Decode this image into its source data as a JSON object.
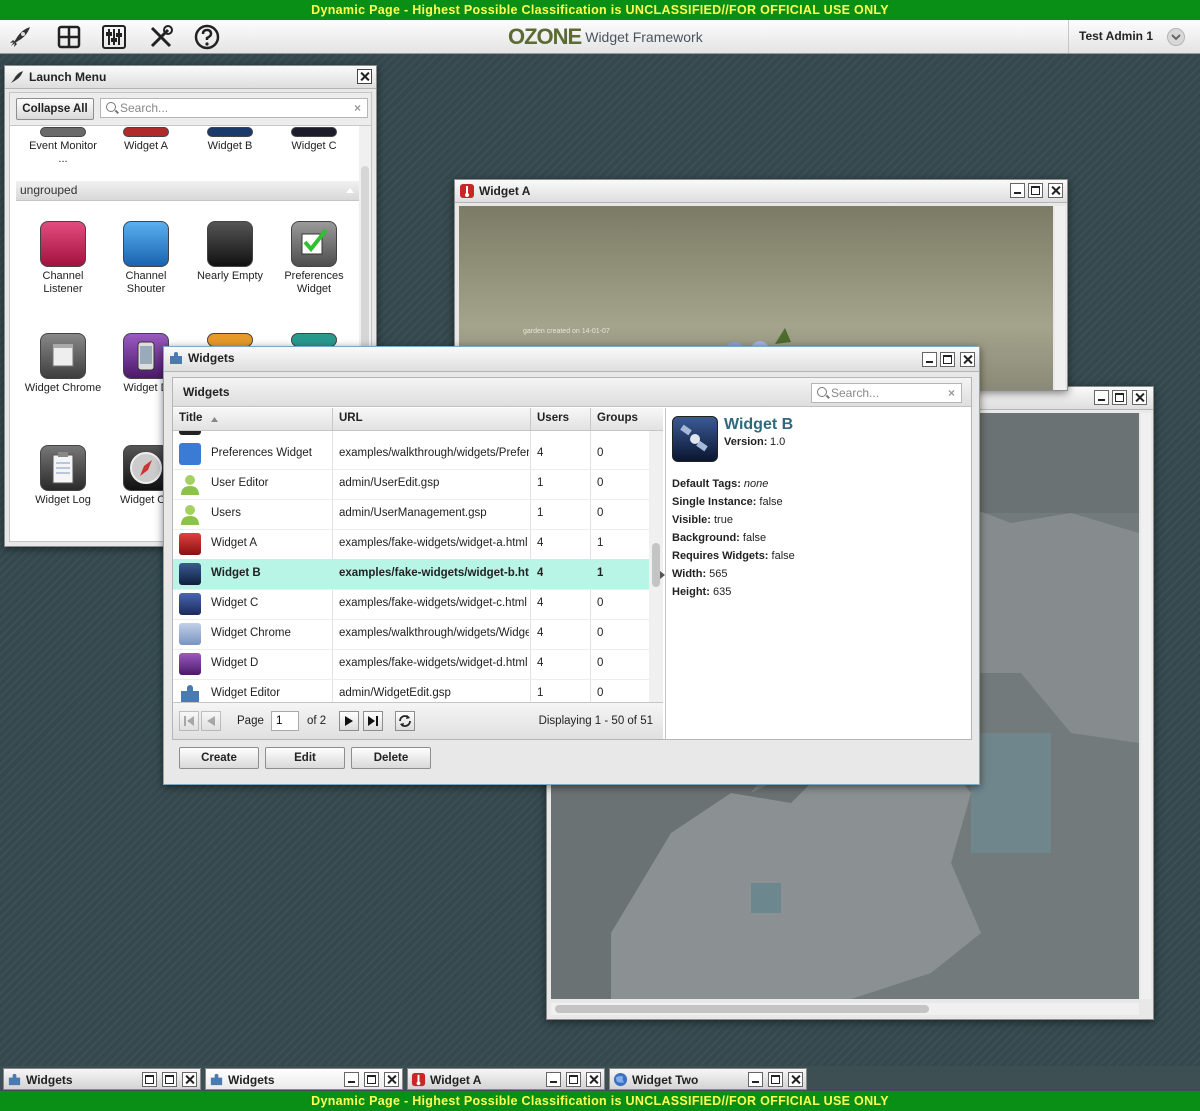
{
  "banner": {
    "top": "Dynamic Page - Highest Possible Classification is UNCLASSIFIED//FOR OFFICIAL USE ONLY",
    "bottom": "Dynamic Page - Highest Possible Classification is UNCLASSIFIED//FOR OFFICIAL USE ONLY",
    "background": "#0a8f16",
    "text_color": "#ffff55"
  },
  "toolbar": {
    "icons": [
      "rocket-icon",
      "dashboard-grid-icon",
      "sliders-icon",
      "tools-icon",
      "help-icon"
    ],
    "logo_mark": "OZONE",
    "logo_text": "Widget Framework",
    "user_name": "Test Admin 1"
  },
  "launch_menu": {
    "title": "Launch Menu",
    "collapse_all": "Collapse All",
    "search_placeholder": "Search...",
    "top_tiles": [
      "Event Monitor ...",
      "Widget A",
      "Widget B",
      "Widget C"
    ],
    "group_name": "ungrouped",
    "tiles": [
      {
        "label": "Channel Listener",
        "icon": "satellite-dish-icon",
        "color": "#c2185b"
      },
      {
        "label": "Channel Shouter",
        "icon": "radio-tower-icon",
        "color": "#1e7fd0"
      },
      {
        "label": "Nearly Empty",
        "icon": "blank-app-icon",
        "color": "#222222"
      },
      {
        "label": "Preferences Widget",
        "icon": "checkbox-icon",
        "color": "#6b6b6b"
      },
      {
        "label": "Widget Chrome",
        "icon": "window-icon",
        "color": "#555555"
      },
      {
        "label": "Widget D",
        "icon": "phone-icon",
        "color": "#6a2c8e"
      },
      {
        "label": "Widget Log",
        "icon": "clipboard-icon",
        "color": "#444444"
      },
      {
        "label": "Widget On",
        "icon": "compass-icon",
        "color": "#333333"
      }
    ]
  },
  "widget_a": {
    "title": "Widget A",
    "caption": "garden created on 14-01-07"
  },
  "widgets_manager": {
    "title": "Widgets",
    "subheader": "Widgets",
    "search_placeholder": "Search...",
    "columns": [
      "Title",
      "URL",
      "Users",
      "Groups"
    ],
    "rows": [
      {
        "title": "Preferences Widget",
        "url": "examples/walkthrough/widgets/Preferences",
        "users": "4",
        "groups": "0",
        "icon": "checkbox-icon",
        "color": "#3a7bd5"
      },
      {
        "title": "User Editor",
        "url": "admin/UserEdit.gsp",
        "users": "1",
        "groups": "0",
        "icon": "user-icon",
        "color": "#8bc34a"
      },
      {
        "title": "Users",
        "url": "admin/UserManagement.gsp",
        "users": "1",
        "groups": "0",
        "icon": "user-icon",
        "color": "#8bc34a"
      },
      {
        "title": "Widget A",
        "url": "examples/fake-widgets/widget-a.html",
        "users": "4",
        "groups": "1",
        "icon": "thermometer-icon",
        "color": "#c62828"
      },
      {
        "title": "Widget B",
        "url": "examples/fake-widgets/widget-b.html",
        "users": "4",
        "groups": "1",
        "icon": "satellite-icon",
        "color": "#1a3a6b",
        "selected": true
      },
      {
        "title": "Widget C",
        "url": "examples/fake-widgets/widget-c.html",
        "users": "4",
        "groups": "0",
        "icon": "monitor-icon",
        "color": "#2a3f7a"
      },
      {
        "title": "Widget Chrome",
        "url": "examples/walkthrough/widgets/WidgetChrome",
        "users": "4",
        "groups": "0",
        "icon": "window-icon",
        "color": "#8aa0c0"
      },
      {
        "title": "Widget D",
        "url": "examples/fake-widgets/widget-d.html",
        "users": "4",
        "groups": "0",
        "icon": "phone-icon",
        "color": "#6a2c8e"
      },
      {
        "title": "Widget Editor",
        "url": "admin/WidgetEdit.gsp",
        "users": "1",
        "groups": "0",
        "icon": "puzzle-icon",
        "color": "#4a7ab0"
      }
    ],
    "pager": {
      "page_label": "Page",
      "page_value": "1",
      "of_label": "of 2",
      "display": "Displaying 1 - 50 of 51"
    },
    "detail": {
      "name": "Widget B",
      "version_label": "Version:",
      "version": "1.0",
      "fields": [
        {
          "label": "Default Tags:",
          "value": "none",
          "italic": true
        },
        {
          "label": "Single Instance:",
          "value": "false"
        },
        {
          "label": "Visible:",
          "value": "true"
        },
        {
          "label": "Background:",
          "value": "false"
        },
        {
          "label": "Requires Widgets:",
          "value": "false"
        },
        {
          "label": "Width:",
          "value": "565"
        },
        {
          "label": "Height:",
          "value": "635"
        }
      ]
    },
    "buttons": [
      "Create",
      "Edit",
      "Delete"
    ]
  },
  "taskbar": [
    {
      "label": "Widgets",
      "icon": "puzzle-icon"
    },
    {
      "label": "Widgets",
      "icon": "puzzle-icon",
      "active": true
    },
    {
      "label": "Widget A",
      "icon": "thermometer-icon"
    },
    {
      "label": "Widget Two",
      "icon": "globe-icon"
    }
  ]
}
